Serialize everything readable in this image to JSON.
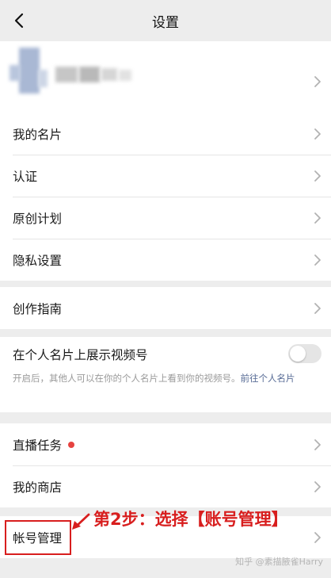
{
  "header": {
    "title": "设置",
    "back_icon": "chevron-left-icon"
  },
  "groups": {
    "g1": {
      "my_card": "我的名片",
      "certification": "认证",
      "original_plan": "原创计划",
      "privacy": "隐私设置"
    },
    "g2": {
      "creation_guide": "创作指南"
    },
    "g3": {
      "show_channel": "在个人名片上展示视频号",
      "toggle_on": false,
      "hint_text": "开启后，其他人可以在你的个人名片上看到你的视频号。",
      "hint_link": "前往个人名片"
    },
    "g4": {
      "live_tasks": "直播任务",
      "my_store": "我的商店"
    },
    "g5": {
      "account_management": "帐号管理"
    }
  },
  "annotation": {
    "text": "第2步：选择【账号管理】",
    "color": "#d81e1e"
  },
  "watermark": "知乎 @素描腋雀Harry",
  "colors": {
    "background": "#ededed",
    "cell": "#ffffff",
    "badge": "#e64340",
    "link": "#576b95"
  }
}
